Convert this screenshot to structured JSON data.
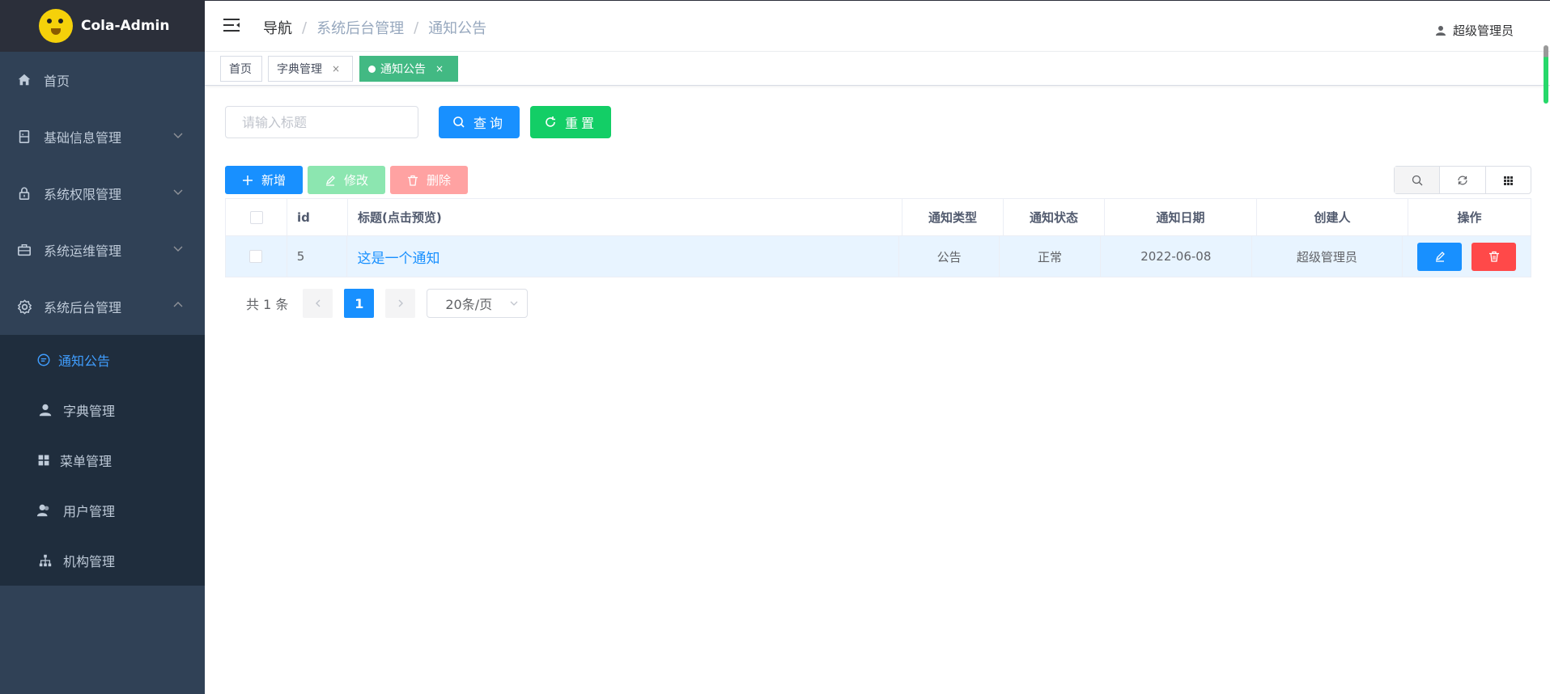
{
  "brand": {
    "name": "Cola-Admin"
  },
  "sidebar": {
    "items": [
      {
        "label": "首页",
        "icon": "home-icon"
      },
      {
        "label": "基础信息管理",
        "icon": "document-icon"
      },
      {
        "label": "系统权限管理",
        "icon": "lock-icon"
      },
      {
        "label": "系统运维管理",
        "icon": "briefcase-icon"
      },
      {
        "label": "系统后台管理",
        "icon": "gear-icon"
      }
    ],
    "subitems": [
      {
        "label": "通知公告",
        "icon": "message-icon"
      },
      {
        "label": "字典管理",
        "icon": "user-icon"
      },
      {
        "label": "菜单管理",
        "icon": "grid-icon"
      },
      {
        "label": "用户管理",
        "icon": "users-icon"
      },
      {
        "label": "机构管理",
        "icon": "org-icon"
      }
    ]
  },
  "header": {
    "breadcrumb": [
      "导航",
      "系统后台管理",
      "通知公告"
    ],
    "separator": "/",
    "user": "超级管理员"
  },
  "tags": {
    "home": "首页",
    "dict": "字典管理",
    "notice": "通知公告",
    "close": "×"
  },
  "search": {
    "placeholder": "请输入标题",
    "query_label": "查询",
    "reset_label": "重置"
  },
  "toolbar": {
    "add_label": "新增",
    "edit_label": "修改",
    "delete_label": "删除"
  },
  "table": {
    "headers": {
      "id": "id",
      "title": "标题(点击预览)",
      "type": "通知类型",
      "status": "通知状态",
      "date": "通知日期",
      "creator": "创建人",
      "ops": "操作"
    },
    "rows": [
      {
        "id": "5",
        "title": "这是一个通知",
        "type": "公告",
        "status": "正常",
        "date": "2022-06-08",
        "creator": "超级管理员"
      }
    ]
  },
  "pagination": {
    "total": "共 1 条",
    "current": "1",
    "page_size": "20条/页"
  },
  "colors": {
    "sidebar_bg": "#304156",
    "primary": "#1890ff",
    "success": "#13ce66",
    "danger": "#ff4949",
    "active_tag": "#42b983"
  }
}
